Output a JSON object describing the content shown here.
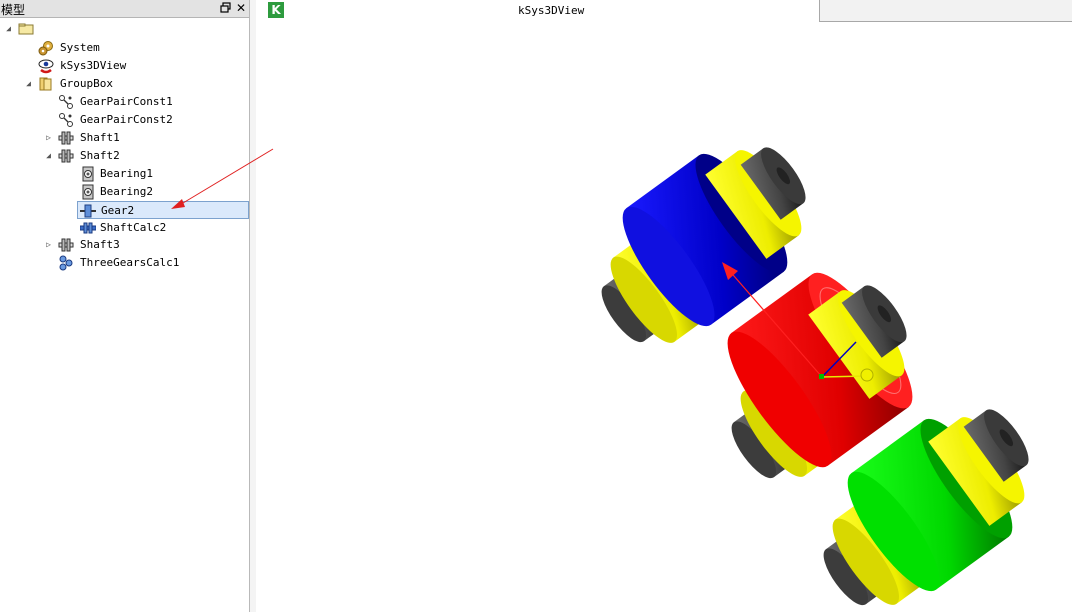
{
  "panel": {
    "title": "模型",
    "pin_icon": "restore-icon",
    "close_label": "✕"
  },
  "tree": {
    "root": {
      "icon": "folder-icon"
    },
    "items": [
      {
        "label": "System",
        "icon": "system-gears-icon"
      },
      {
        "label": "kSys3DView",
        "icon": "eye-icon"
      },
      {
        "label": "GroupBox",
        "icon": "folder-icon",
        "expanded": true
      },
      {
        "label": "GearPairConst1",
        "icon": "constraint-icon"
      },
      {
        "label": "GearPairConst2",
        "icon": "constraint-icon"
      },
      {
        "label": "Shaft1",
        "icon": "shaft-icon",
        "expanded": false
      },
      {
        "label": "Shaft2",
        "icon": "shaft-icon",
        "expanded": true
      },
      {
        "label": "Bearing1",
        "icon": "bearing-icon"
      },
      {
        "label": "Bearing2",
        "icon": "bearing-icon"
      },
      {
        "label": "Gear2",
        "icon": "gear-part-icon",
        "selected": true
      },
      {
        "label": "ShaftCalc2",
        "icon": "shaft-calc-icon"
      },
      {
        "label": "Shaft3",
        "icon": "shaft-icon",
        "expanded": false
      },
      {
        "label": "ThreeGearsCalc1",
        "icon": "gears-calc-icon"
      }
    ]
  },
  "view": {
    "logo_letter": "K",
    "title": "kSys3DView"
  },
  "colors": {
    "gear_blue": "#0a0ad2",
    "gear_red": "#e60000",
    "gear_green": "#0ad60a",
    "bearing_yellow": "#f0f000",
    "shaft_gray": "#4a4a4a",
    "selection": "#dbe9fb",
    "annotation_arrow": "#e02020"
  }
}
